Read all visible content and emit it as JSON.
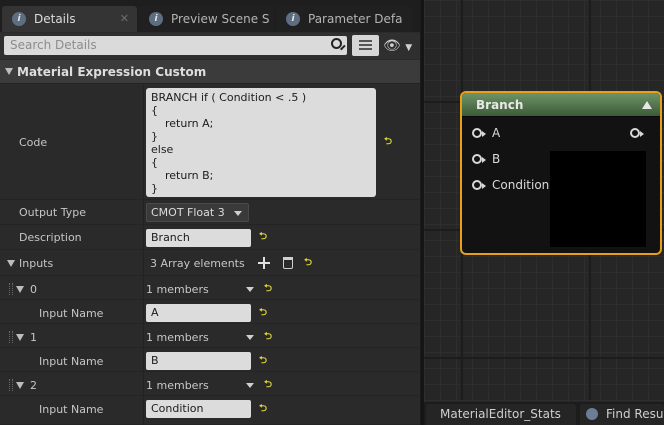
{
  "details_panel": {
    "tabs": [
      {
        "label": "Details",
        "icon": "info-icon",
        "active": true
      },
      {
        "label": "Preview Scene S",
        "icon": "info-icon",
        "active": false
      },
      {
        "label": "Parameter Defa",
        "icon": "info-icon",
        "active": false
      }
    ],
    "search": {
      "placeholder": "Search Details"
    },
    "category_title": "Material Expression Custom",
    "code_label": "Code",
    "code_lines": [
      "BRANCH if ( Condition < .5 )",
      "{",
      "    return A;",
      "}",
      "else",
      "{",
      "    return B;",
      "}"
    ],
    "output_type_label": "Output Type",
    "output_type_value": "CMOT Float 3",
    "description_label": "Description",
    "description_value": "Branch",
    "inputs_label": "Inputs",
    "inputs_count": "3 Array elements",
    "input_items": [
      {
        "index": "0",
        "members": "1 members",
        "name_label": "Input Name",
        "name_value": "A"
      },
      {
        "index": "1",
        "members": "1 members",
        "name_label": "Input Name",
        "name_value": "B"
      },
      {
        "index": "2",
        "members": "1 members",
        "name_label": "Input Name",
        "name_value": "Condition"
      }
    ]
  },
  "graph": {
    "node": {
      "title": "Branch",
      "header_color": "#5a7d52",
      "border_color": "#e89f19",
      "inputs": [
        "A",
        "B",
        "Condition"
      ]
    }
  },
  "bottom_tabs": [
    {
      "label": "MaterialEditor_Stats"
    },
    {
      "label": "Find Resul",
      "icon": "search-icon"
    }
  ]
}
